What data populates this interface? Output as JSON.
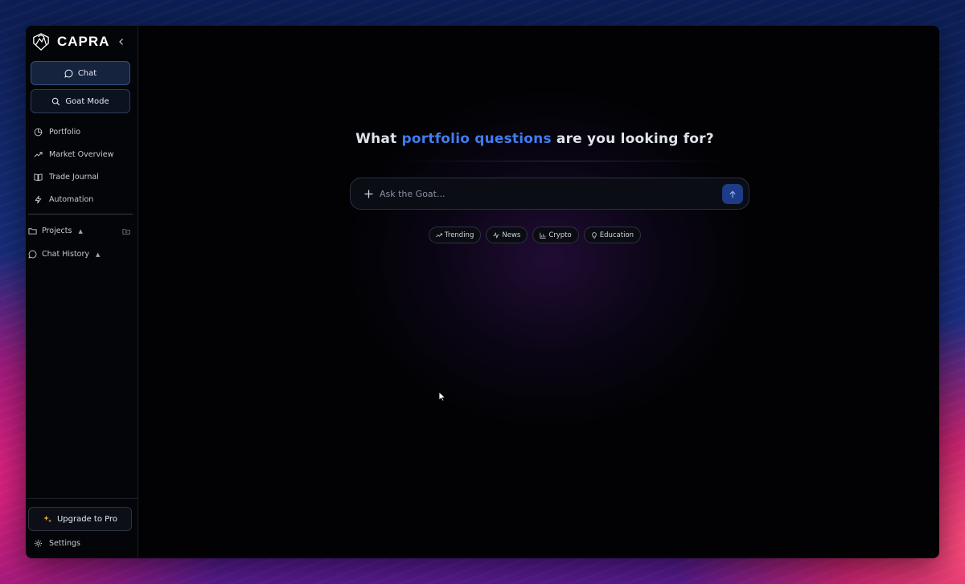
{
  "brand": {
    "name": "CAPRA",
    "logo_icon": "goat-logo-icon"
  },
  "sidebar": {
    "buttons": [
      {
        "label": "Chat",
        "icon": "chat-bubble-icon",
        "active": true
      },
      {
        "label": "Goat Mode",
        "icon": "search-icon",
        "active": false
      }
    ],
    "nav": [
      {
        "label": "Portfolio",
        "icon": "pie-chart-icon"
      },
      {
        "label": "Market Overview",
        "icon": "trending-up-icon"
      },
      {
        "label": "Trade Journal",
        "icon": "book-icon"
      },
      {
        "label": "Automation",
        "icon": "lightning-icon"
      }
    ],
    "sections": [
      {
        "label": "Projects",
        "icon": "folder-icon",
        "expanded": true
      },
      {
        "label": "Chat History",
        "icon": "chat-bubble-icon",
        "expanded": true
      }
    ],
    "upgrade_label": "Upgrade to Pro",
    "settings_label": "Settings"
  },
  "main": {
    "headline": {
      "before": "What ",
      "accent": "portfolio questions",
      "after": " are you looking for?"
    },
    "ask": {
      "placeholder": "Ask the Goat...",
      "value": ""
    },
    "chips": [
      {
        "label": "Trending",
        "icon": "trending-up-icon"
      },
      {
        "label": "News",
        "icon": "activity-icon"
      },
      {
        "label": "Crypto",
        "icon": "bar-chart-icon"
      },
      {
        "label": "Education",
        "icon": "lightbulb-icon"
      }
    ]
  },
  "colors": {
    "accent": "#3f7df0",
    "window_bg": "#020204",
    "active_button_bg": "#15233e",
    "send_button_bg": "#1d3b88"
  }
}
